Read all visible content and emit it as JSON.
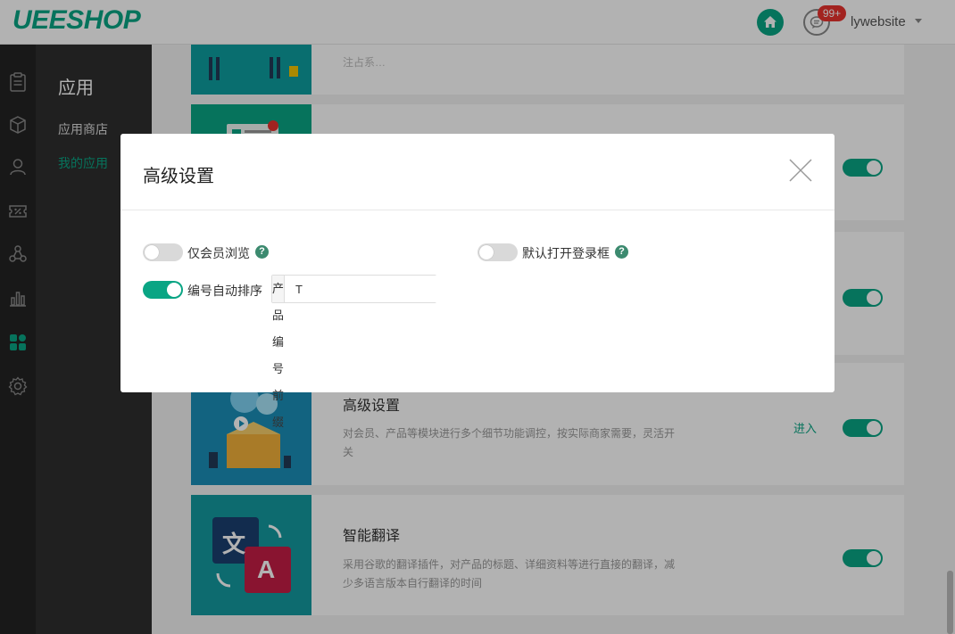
{
  "header": {
    "logo": "UEESHOP",
    "badge": "99+",
    "user": "lywebsite"
  },
  "subnav": {
    "title": "应用",
    "items": [
      {
        "label": "应用商店",
        "active": false
      },
      {
        "label": "我的应用",
        "active": true
      }
    ]
  },
  "rail_icons": [
    "clipboard-icon",
    "box-icon",
    "user-icon",
    "coupon-icon",
    "share-icon",
    "chart-icon",
    "apps-icon",
    "gear-icon"
  ],
  "cards": [
    {
      "title": "",
      "desc": "注占系…",
      "enter": "",
      "toggle": "none"
    },
    {
      "title": "",
      "desc": "",
      "enter": "",
      "toggle": "on"
    },
    {
      "title": "",
      "desc": "",
      "enter": "",
      "toggle": "on"
    },
    {
      "title": "高级设置",
      "desc": "对会员、产品等模块进行多个细节功能调控，按实际商家需要，灵活开关",
      "enter": "进入",
      "toggle": "on"
    },
    {
      "title": "智能翻译",
      "desc": "采用谷歌的翻译插件，对产品的标题、详细资料等进行直接的翻译，减少多语言版本自行翻译的时间",
      "enter": "",
      "toggle": "on"
    }
  ],
  "translate_icon": {
    "left_char": "文",
    "right_char": "A"
  },
  "modal": {
    "title": "高级设置",
    "options": [
      {
        "label": "仅会员浏览",
        "state": "off",
        "help": "?"
      },
      {
        "label": "默认打开登录框",
        "state": "off",
        "help": "?"
      },
      {
        "label": "编号自动排序",
        "state": "on"
      }
    ],
    "prefix": {
      "label": "产品编号前缀",
      "value": "T"
    }
  },
  "colors": {
    "accent": "#0aa584",
    "badge": "#e8332f",
    "help": "#3c8a6f"
  }
}
